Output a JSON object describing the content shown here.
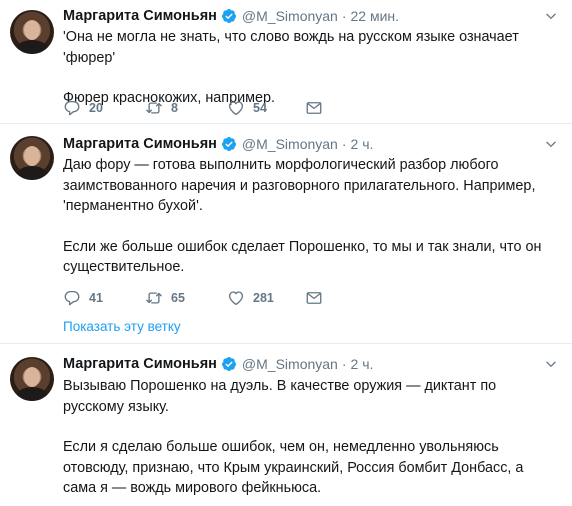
{
  "tweets": [
    {
      "name": "Маргарита Симоньян",
      "handle": "@M_Simonyan",
      "separator": "·",
      "time": "22 мин.",
      "paragraphs": [
        "'Она не могла не знать, что слово вождь на русском языке означает 'фюрер'",
        "Фюрер краснокожих, например."
      ],
      "replies": "20",
      "retweets": "8",
      "likes": "54"
    },
    {
      "name": "Маргарита Симоньян",
      "handle": "@M_Simonyan",
      "separator": "·",
      "time": "2 ч.",
      "paragraphs": [
        "Даю фору — готова выполнить морфологический разбор любого заимствованного наречия и разговорного прилагательного. Например, 'перманентно бухой'.",
        "Если же больше ошибок сделает Порошенко, то мы и так знали, что он существительное."
      ],
      "replies": "41",
      "retweets": "65",
      "likes": "281",
      "thread_link": "Показать эту ветку"
    },
    {
      "name": "Маргарита Симоньян",
      "handle": "@M_Simonyan",
      "separator": "·",
      "time": "2 ч.",
      "paragraphs": [
        "Вызываю Порошенко на дуэль. В качестве оружия — диктант по русскому языку.",
        "Если я сделаю больше ошибок, чем он, немедленно увольняюсь отовсюду, признаю, что Крым украинский, Россия бомбит Донбасс, а сама я — вождь мирового фейкньюса."
      ]
    }
  ],
  "icons": {
    "verified": "verified-badge-icon",
    "caret": "chevron-down-icon",
    "reply": "reply-icon",
    "retweet": "retweet-icon",
    "like": "heart-icon",
    "message": "direct-message-icon"
  },
  "colors": {
    "text": "#14171a",
    "secondary": "#657786",
    "accent": "#1da1f2",
    "divider": "#e6ecf0"
  }
}
